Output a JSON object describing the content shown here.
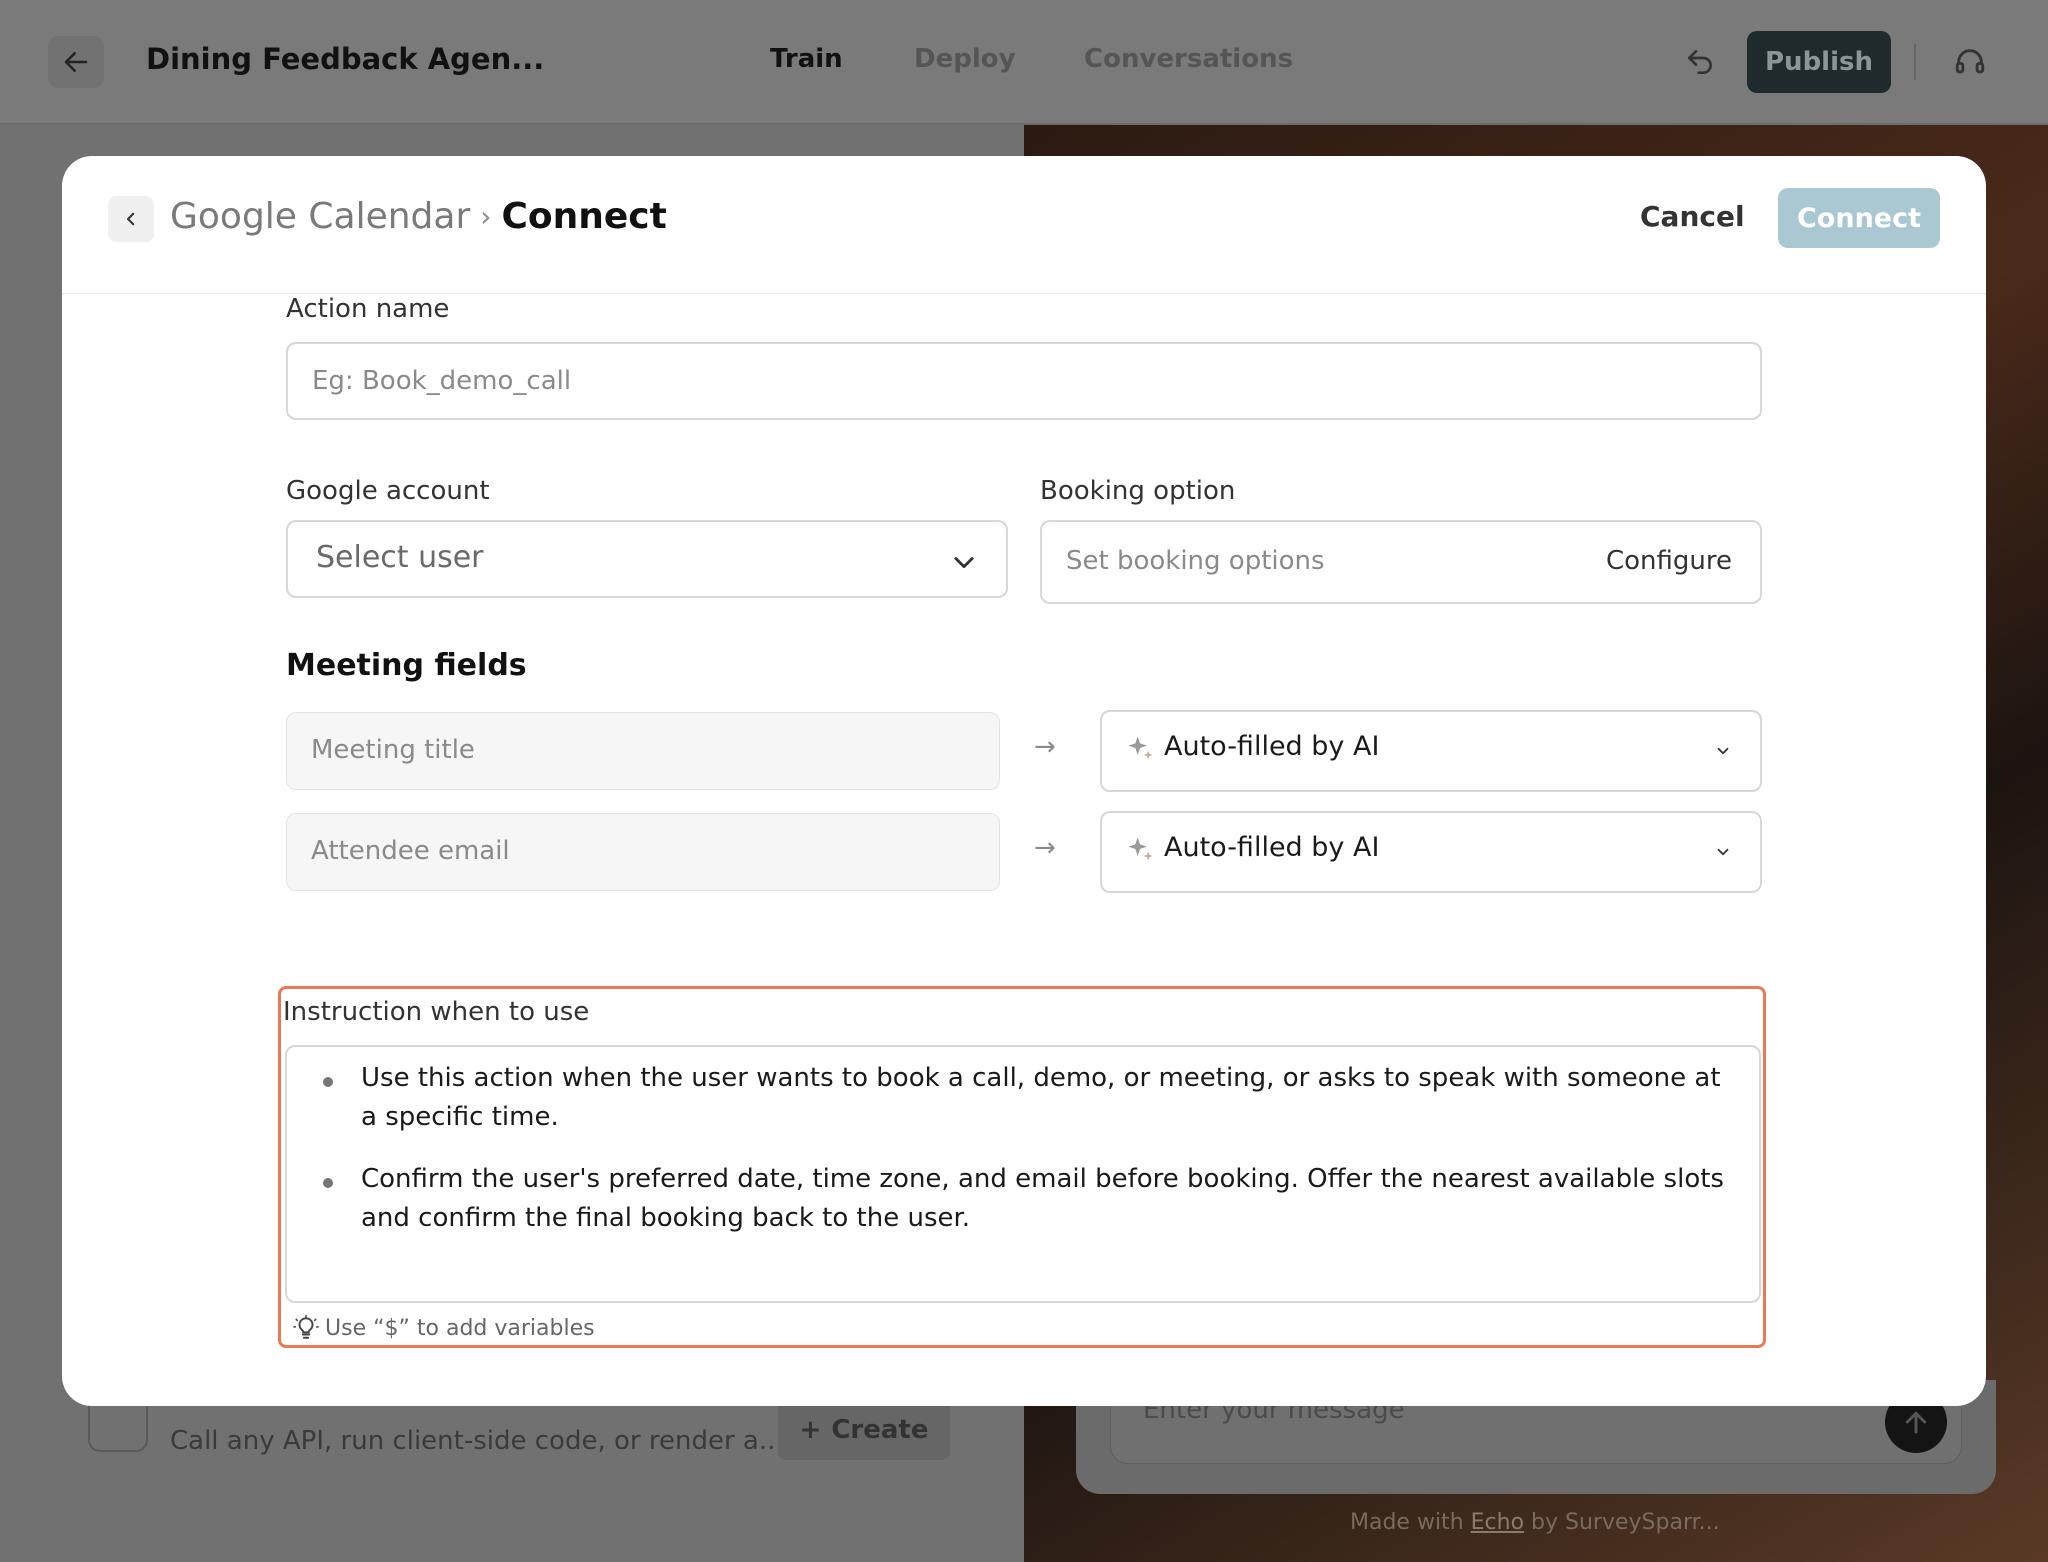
{
  "header": {
    "title": "Dining Feedback Agen...",
    "tabs": [
      {
        "label": "Train",
        "active": true
      },
      {
        "label": "Deploy",
        "active": false
      },
      {
        "label": "Conversations",
        "active": false
      }
    ],
    "publish_label": "Publish"
  },
  "background": {
    "action_description": "Call any API, run client-side code, or render a...",
    "create_label": "Create",
    "chat_placeholder": "Enter your message",
    "made_with_prefix": "Made with ",
    "made_with_link": "Echo",
    "made_with_suffix": " by SurveySparr..."
  },
  "modal": {
    "breadcrumb_parent": "Google Calendar",
    "breadcrumb_separator": "›",
    "breadcrumb_current": "Connect",
    "cancel_label": "Cancel",
    "connect_label": "Connect",
    "action_name": {
      "label": "Action name",
      "placeholder": "Eg: Book_demo_call",
      "value": ""
    },
    "google_account": {
      "label": "Google account",
      "selected": "Select user"
    },
    "booking_option": {
      "label": "Booking option",
      "placeholder": "Set booking options",
      "configure_label": "Configure"
    },
    "meeting_fields": {
      "title": "Meeting fields",
      "rows": [
        {
          "field": "Meeting title",
          "arrow": "→",
          "mapping": "Auto-filled by AI"
        },
        {
          "field": "Attendee email",
          "arrow": "→",
          "mapping": "Auto-filled by AI"
        }
      ]
    },
    "instruction": {
      "label": "Instruction when to use",
      "bullets": [
        "Use this action when the user wants to book a call, demo, or meeting, or asks to speak with someone at a specific time.",
        "Confirm the user's preferred date, time zone, and email before booking. Offer the nearest available slots and confirm the final booking back to the user."
      ],
      "hint": "Use “$” to add variables"
    }
  },
  "colors": {
    "highlight_border": "#ea7a54",
    "connect_button": "#a9c8d2",
    "publish_button": "#1e2a2c"
  }
}
